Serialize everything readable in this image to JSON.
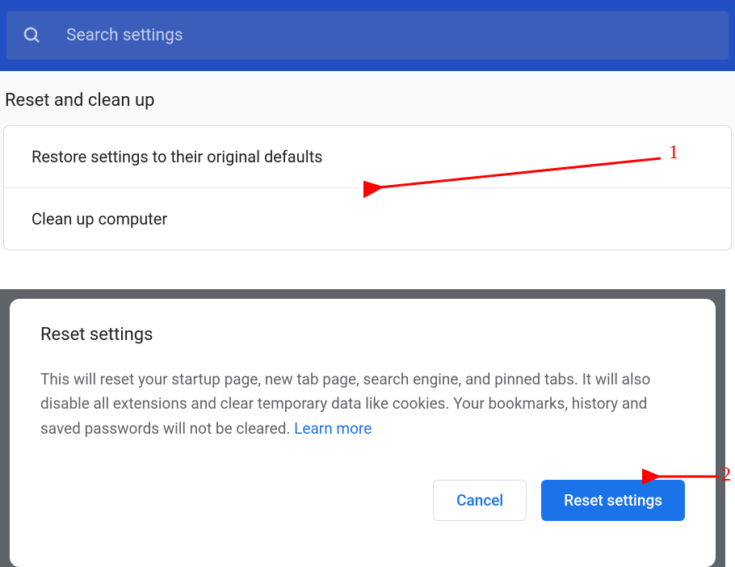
{
  "search": {
    "placeholder": "Search settings"
  },
  "section": {
    "title": "Reset and clean up",
    "options": [
      "Restore settings to their original defaults",
      "Clean up computer"
    ]
  },
  "modal": {
    "title": "Reset settings",
    "body": "This will reset your startup page, new tab page, search engine, and pinned tabs. It will also disable all extensions and clear temporary data like cookies. Your bookmarks, history and saved passwords will not be cleared. ",
    "learn_more": "Learn more",
    "cancel": "Cancel",
    "confirm": "Reset settings"
  },
  "annotations": {
    "a1": "1",
    "a2": "2"
  }
}
